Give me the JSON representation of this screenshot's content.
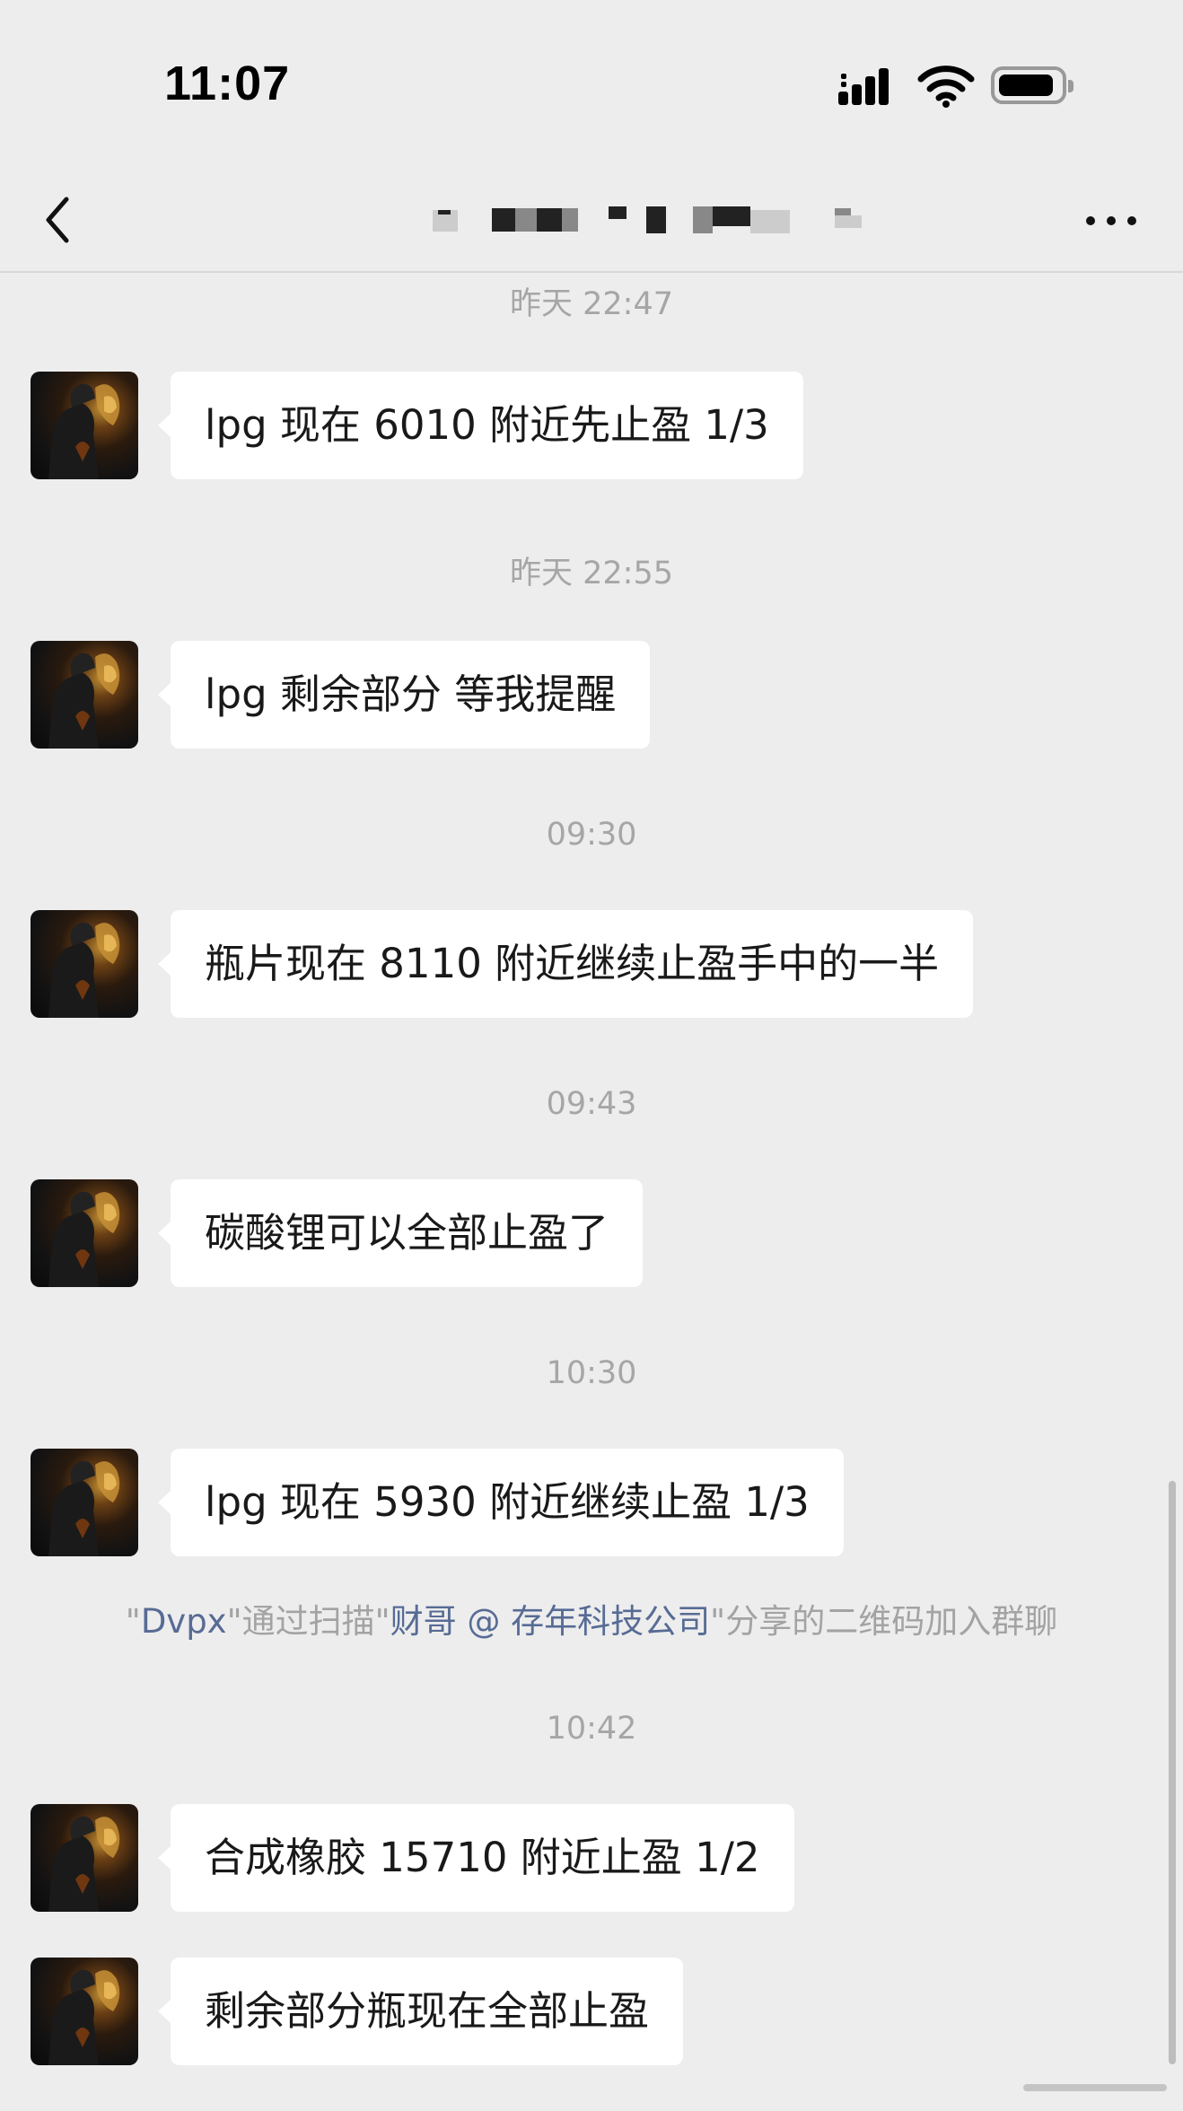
{
  "status_bar": {
    "time": "11:07"
  },
  "nav": {
    "title": ""
  },
  "messages": [
    {
      "time": "昨天 22:47",
      "text": "lpg 现在 6010 附近先止盈 1/3"
    },
    {
      "time": "昨天 22:55",
      "text": "lpg 剩余部分 等我提醒"
    },
    {
      "time": "09:30",
      "text": "瓶片现在 8110 附近继续止盈手中的一半"
    },
    {
      "time": "09:43",
      "text": "碳酸锂可以全部止盈了"
    },
    {
      "time": "10:30",
      "text": "lpg 现在 5930 附近继续止盈 1/3"
    },
    {
      "time": "10:42",
      "text": "合成橡胶 15710 附近止盈 1/2"
    },
    {
      "time": "",
      "text": "剩余部分瓶现在全部止盈"
    }
  ],
  "system_note": {
    "q1": "\"",
    "user": "Dvpx",
    "mid": "\"通过扫描\"",
    "inviter": "财哥 @ 存年科技公司",
    "end": "\"分享的二维码加入群聊"
  },
  "icons": {
    "back": "chevron-left-icon",
    "more": "more-dots-icon",
    "signal": "cellular-signal-icon",
    "wifi": "wifi-icon",
    "battery": "battery-icon"
  },
  "colors": {
    "background": "#ededed",
    "bubble": "#ffffff",
    "link": "#576b95",
    "timestamp": "#a6a6a6"
  }
}
